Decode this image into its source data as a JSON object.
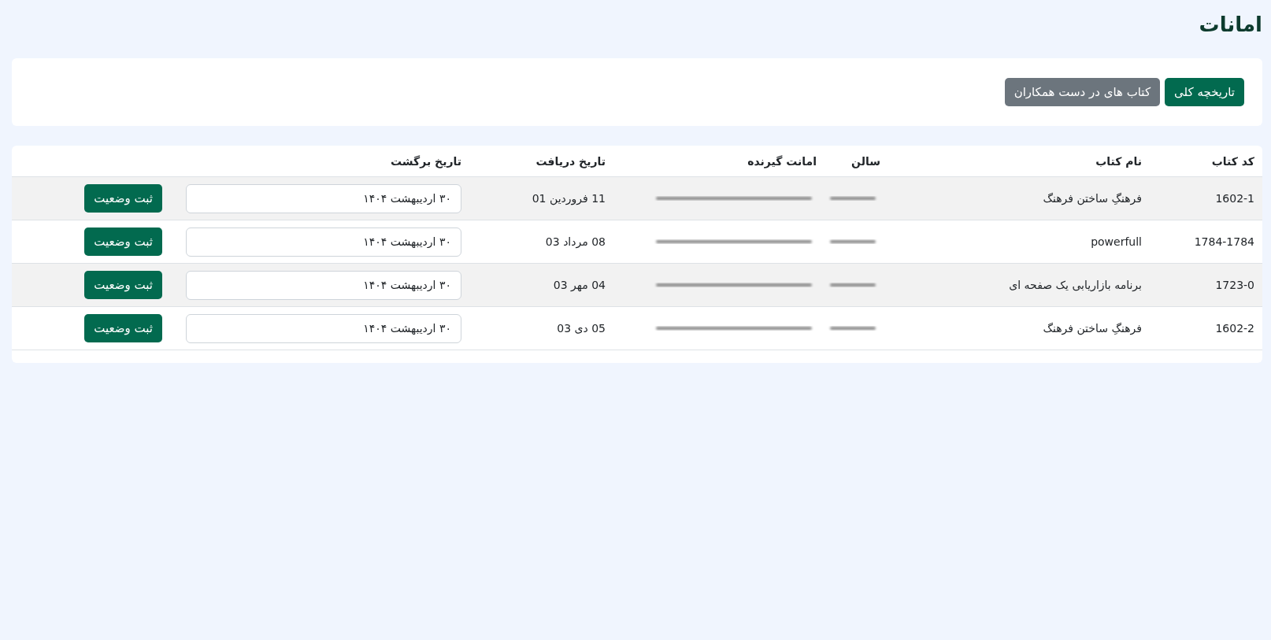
{
  "page_title": "امانات",
  "actions": [
    {
      "label": "تاریخچه کلی",
      "kind": "primary"
    },
    {
      "label": "کتاب های در دست همکاران",
      "kind": "secondary"
    }
  ],
  "table": {
    "columns": [
      "کد کتاب",
      "نام کتاب",
      "سالن",
      "امانت گیرنده",
      "تاریخ دریافت",
      "تاریخ برگشت"
    ],
    "rows": [
      {
        "code": "1602-1",
        "title": "فرهنگِ ساختن فرهنگ",
        "hall_blurred": true,
        "borrower_blurred": true,
        "received": "11 فروردین 01",
        "return_date": "۳۰ اردیبهشت ۱۴۰۴",
        "button": "ثبت وضعیت"
      },
      {
        "code": "1784-1784",
        "title": "powerfull",
        "hall_blurred": true,
        "borrower_blurred": true,
        "received": "08 مرداد 03",
        "return_date": "۳۰ اردیبهشت ۱۴۰۴",
        "button": "ثبت وضعیت"
      },
      {
        "code": "1723-0",
        "title": "برنامه بازاریابی یک صفحه ای",
        "hall_blurred": true,
        "borrower_blurred": true,
        "received": "04 مهر 03",
        "return_date": "۳۰ اردیبهشت ۱۴۰۴",
        "button": "ثبت وضعیت"
      },
      {
        "code": "1602-2",
        "title": "فرهنگِ ساختن فرهنگ",
        "hall_blurred": true,
        "borrower_blurred": true,
        "received": "05 دی 03",
        "return_date": "۳۰ اردیبهشت ۱۴۰۴",
        "button": "ثبت وضعیت"
      }
    ]
  }
}
